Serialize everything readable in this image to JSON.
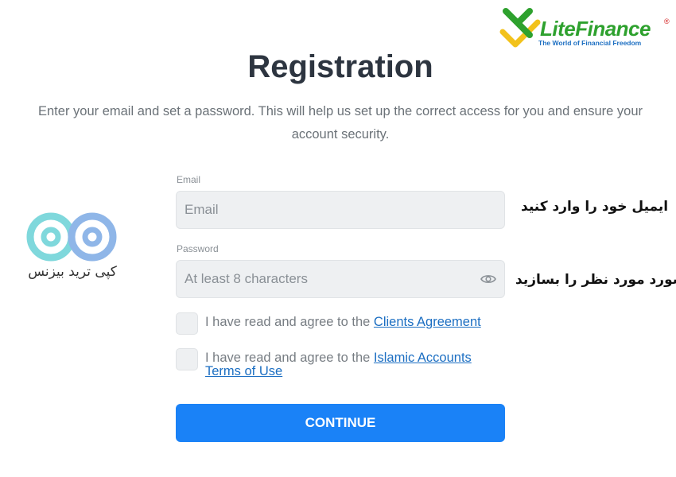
{
  "brand": {
    "name": "LiteFinance",
    "tagline": "The World of Financial Freedom",
    "registered_mark": "®",
    "colors": {
      "green": "#2ea12e",
      "yellow": "#f2c21b",
      "blue": "#1d6fc2"
    }
  },
  "page": {
    "title": "Registration",
    "subtitle": "Enter your email and set a password. This will help us set up the correct access for you and ensure your account security."
  },
  "form": {
    "email": {
      "label": "Email",
      "placeholder": "Email",
      "value": ""
    },
    "password": {
      "label": "Password",
      "placeholder": "At least 8 characters",
      "value": "",
      "toggle_icon": "eye-icon"
    },
    "agreements": [
      {
        "prefix": "I have read and agree to the ",
        "link": "Clients Agreement",
        "checked": false
      },
      {
        "prefix": "I have read and agree to the ",
        "link": "Islamic Accounts Terms of Use",
        "checked": false
      }
    ],
    "continue_label": "CONTINUE",
    "accent_color": "#1a82f7"
  },
  "annotations": {
    "email_note": "ایمیل خود را وارد کنید",
    "password_note": "پسورد مورد نظر را بسازید"
  },
  "watermark": {
    "text": "کپی ترید بیزنس",
    "icon": "infinity-logo-icon"
  }
}
